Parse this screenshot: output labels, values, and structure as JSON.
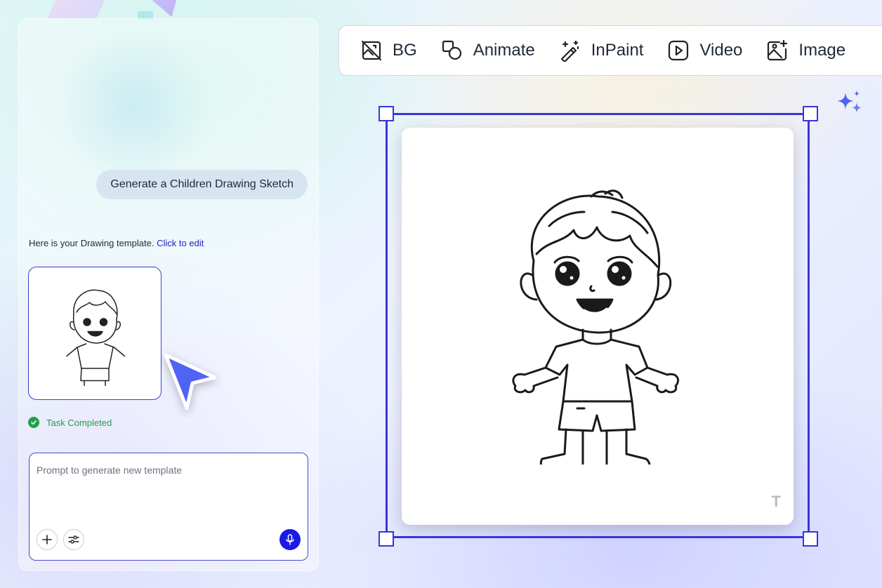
{
  "chat": {
    "user_prompt": "Generate a Children Drawing Sketch",
    "reply_text": "Here is your Drawing template.",
    "reply_link": "Click to edit",
    "status": "Task Completed",
    "input_placeholder": "Prompt to generate new template"
  },
  "toolbar": {
    "items": [
      {
        "label": "BG",
        "icon": "image-off-icon"
      },
      {
        "label": "Animate",
        "icon": "shapes-icon"
      },
      {
        "label": "InPaint",
        "icon": "magic-wand-icon"
      },
      {
        "label": "Video",
        "icon": "video-play-icon"
      },
      {
        "label": "Image",
        "icon": "image-plus-icon"
      }
    ]
  },
  "canvas": {
    "watermark": "T"
  },
  "colors": {
    "accent": "#3b35d6",
    "link": "#2121c8",
    "success": "#22a04b",
    "mic": "#1a1ae6"
  }
}
